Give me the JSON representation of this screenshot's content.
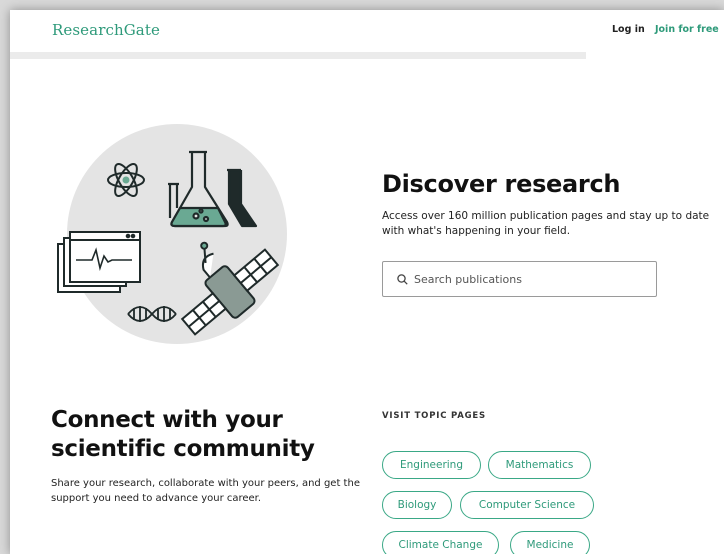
{
  "header": {
    "logo": "ResearchGate",
    "login_label": "Log in",
    "join_label": "Join for free"
  },
  "hero": {
    "title": "Discover research",
    "subtitle": "Access over 160 million publication pages and stay up to date with what's happening in your field.",
    "search_placeholder": "Search publications"
  },
  "community": {
    "title_line1": "Connect with your",
    "title_line2": "scientific community",
    "subtitle": "Share your research, collaborate with your peers, and get the support you need to advance your career."
  },
  "topics": {
    "label": "VISIT TOPIC PAGES",
    "items": [
      "Engineering",
      "Mathematics",
      "Biology",
      "Computer Science",
      "Climate Change",
      "Medicine"
    ]
  },
  "colors": {
    "brand": "#2e9a7a",
    "illustration_circle": "#e4e4e4",
    "illustration_accent": "#6aa993",
    "ink": "#1f2a2a"
  }
}
